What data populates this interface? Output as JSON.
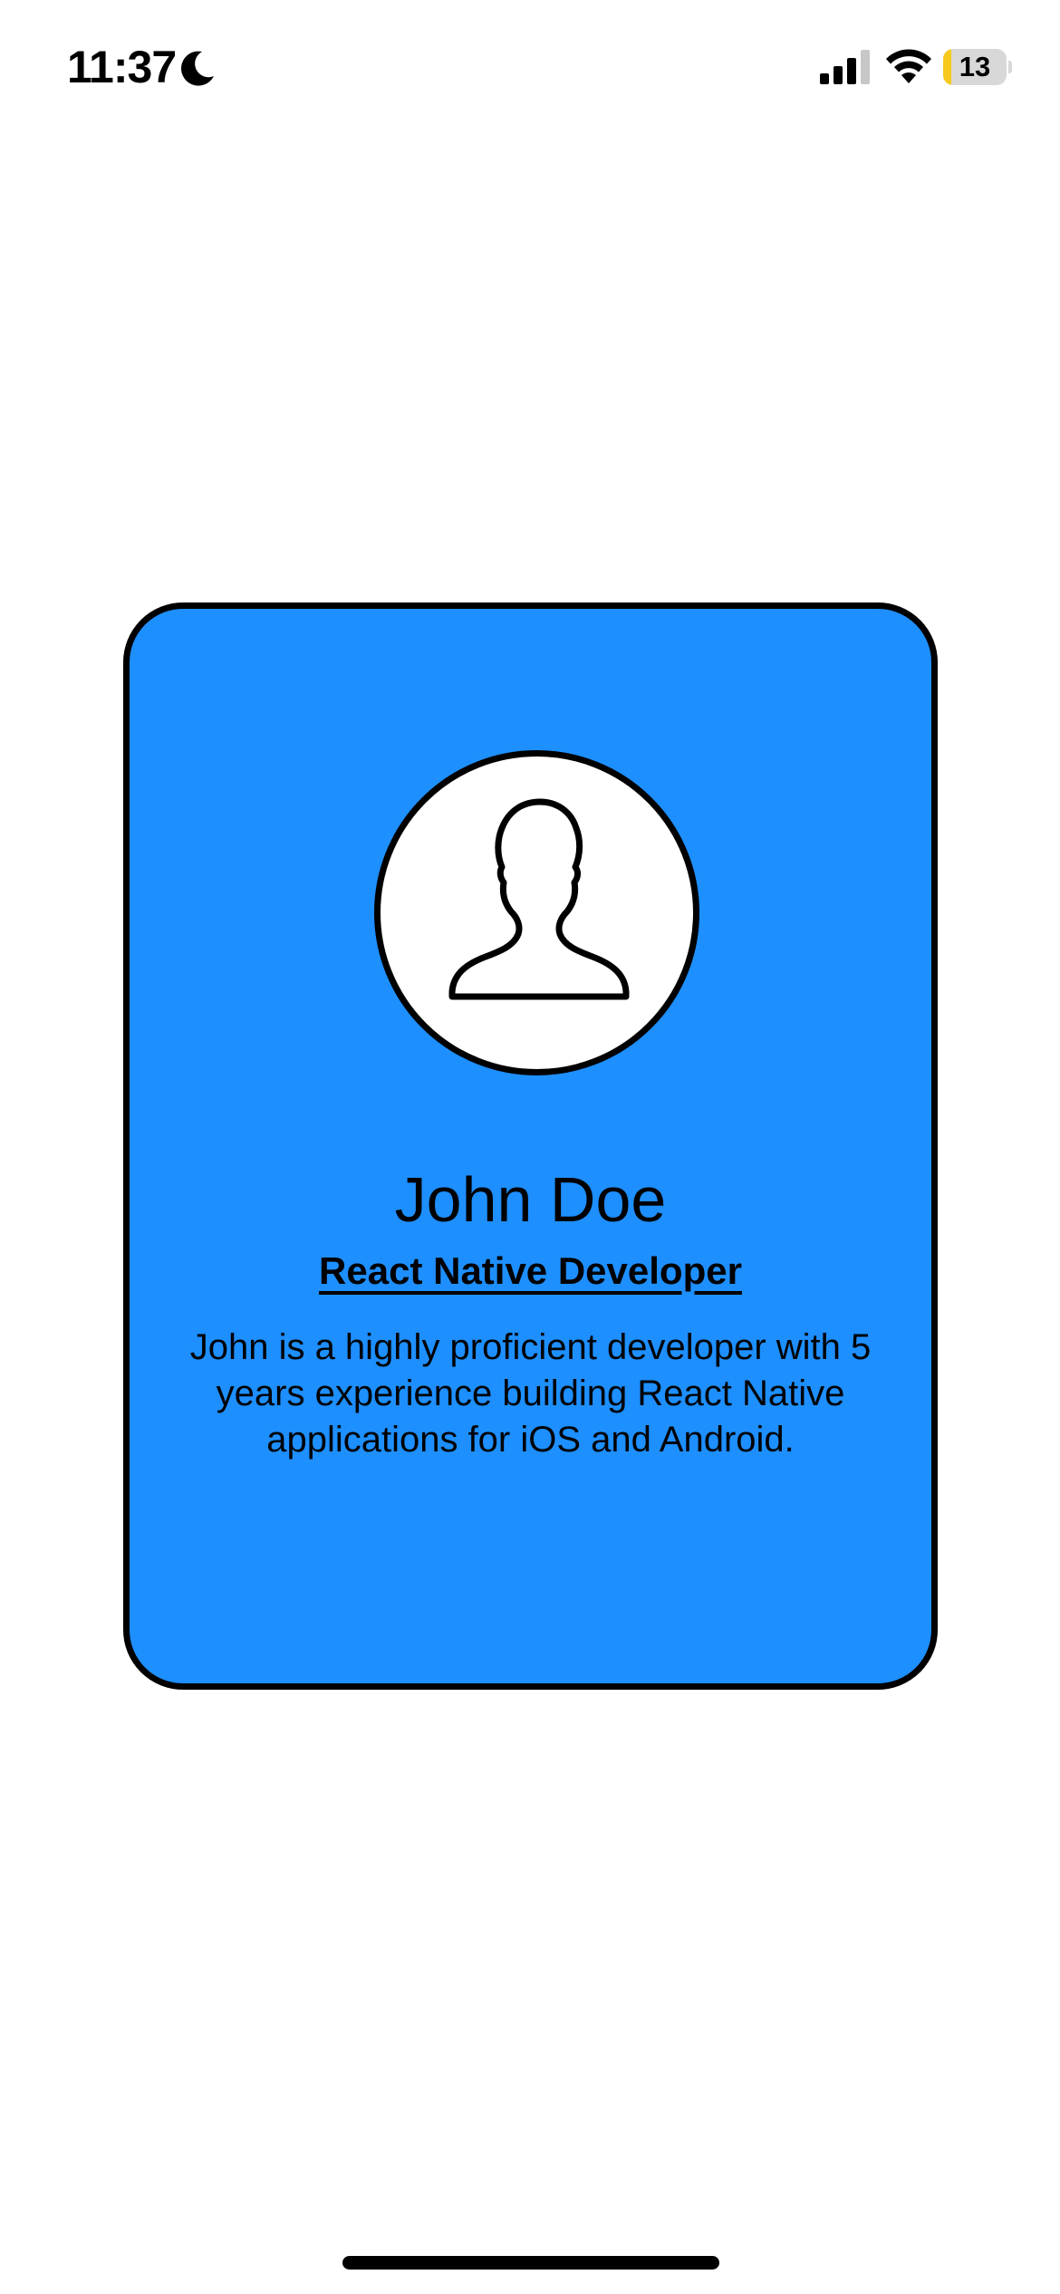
{
  "status_bar": {
    "time": "11:37",
    "focus_mode_icon": "moon-icon",
    "signal_icon": "cellular-signal-icon",
    "signal_bars": 3,
    "signal_bars_total": 4,
    "wifi_icon": "wifi-icon",
    "battery_percent": "13",
    "battery_level": 0.13,
    "battery_color": "#f7c91d"
  },
  "profile_card": {
    "background_color": "#1e8fff",
    "border_color": "#000000",
    "avatar_icon": "user-silhouette-icon",
    "name": "John Doe",
    "title": "React Native Developer",
    "bio": "John is a highly proficient developer with 5 years experience building React Native applications for iOS and Android."
  }
}
